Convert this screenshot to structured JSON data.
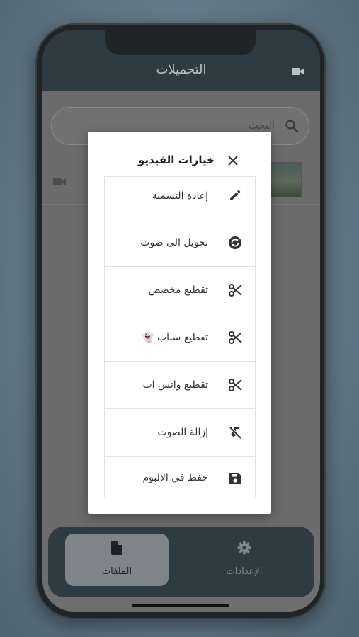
{
  "appbar": {
    "title": "التحميلات",
    "camera_icon": "video-camera-icon"
  },
  "search": {
    "placeholder": "البحث",
    "icon": "search-icon"
  },
  "list": {
    "row_icon": "video-camera-icon",
    "thumbnail": "video-thumbnail"
  },
  "dialog": {
    "title": "خيارات الفيديو",
    "close_icon": "close-icon",
    "options": [
      {
        "label": "إعادة التسمية",
        "icon": "pencil-icon"
      },
      {
        "label": "تحويل الى صوت",
        "icon": "convert-audio-icon"
      },
      {
        "label": "تقطيع مخصص",
        "icon": "scissors-icon"
      },
      {
        "label": "تقطيع سناب 👻",
        "icon": "scissors-icon"
      },
      {
        "label": "تقطيع واتس اب",
        "icon": "scissors-icon"
      },
      {
        "label": "إزالة الصوت",
        "icon": "mute-icon"
      },
      {
        "label": "حفظ في الالبوم",
        "icon": "save-icon"
      }
    ]
  },
  "bottom_nav": {
    "files": {
      "label": "الملفات",
      "icon": "file-icon"
    },
    "settings": {
      "label": "الإعدادات",
      "icon": "gear-icon"
    }
  },
  "colors": {
    "appbar": "#2e3b43",
    "overlay": "#6b6b6b",
    "dialog": "#ffffff",
    "files_tab_active": "#7e8488"
  }
}
